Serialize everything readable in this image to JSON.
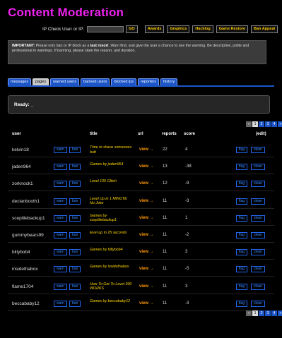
{
  "page": {
    "title": "Content Moderation"
  },
  "topbar": {
    "ip_label": "IP Check User or IP:",
    "ip_value": "",
    "go_label": "GO",
    "nav": [
      "Awards",
      "Graphics",
      "Hacklog",
      "Game Restore",
      "Ban Appeal"
    ]
  },
  "notice": {
    "bold_prefix": "IMPORTANT:",
    "part1": " Please only ban or IP block as a ",
    "last_resort": "last resort",
    "part2": ". Warn first, and give the user a chance to see the warning. Be descriptive, polite and professional in warnings. If banning, please state the reason, and duration."
  },
  "tabs": [
    {
      "label": "messages",
      "active": false
    },
    {
      "label": "pages",
      "active": true
    },
    {
      "label": "warned users",
      "active": false
    },
    {
      "label": "banned users",
      "active": false
    },
    {
      "label": "blocked ips",
      "active": false
    },
    {
      "label": "reporters",
      "active": false
    },
    {
      "label": "history",
      "active": false
    }
  ],
  "status": {
    "text": "Ready: _"
  },
  "pager": {
    "prev": "«",
    "pages": [
      "1",
      "2",
      "3",
      "4"
    ],
    "next": "»",
    "current": "1"
  },
  "table": {
    "headers": {
      "user": "user",
      "title": "title",
      "url": "url",
      "reports": "reports",
      "score": "score",
      "edit": "(edit)"
    },
    "warn_label": "warn",
    "ban_label": "ban",
    "flag_label": "flag",
    "clean_label": "clean",
    "view_label": "view →",
    "rows": [
      {
        "user": "kelvin18",
        "title": "Time to shave someones butt",
        "reports": "22",
        "score": "4"
      },
      {
        "user": "jaden964",
        "title": "Games by jaden964",
        "reports": "13",
        "score": "-38"
      },
      {
        "user": "zorknock1",
        "title": "Level 100 Glitch",
        "reports": "12",
        "score": "-9"
      },
      {
        "user": "declanbooth1",
        "title": "Level Up in 1 MINUTE No Joke",
        "reports": "11",
        "score": "-3"
      },
      {
        "user": "sceptilebackup1",
        "title": "Games by sceptilebackup1",
        "reports": "11",
        "score": "1"
      },
      {
        "user": "gummybears99",
        "title": "level up in 25 seconds",
        "reports": "11",
        "score": "-2"
      },
      {
        "user": "billybob4",
        "title": "Games by billybob4",
        "reports": "11",
        "score": "3"
      },
      {
        "user": "insidethabox",
        "title": "Games by insidethabox",
        "reports": "11",
        "score": "-5"
      },
      {
        "user": "flame1704",
        "title": "How To Get To Level 300 WORKS",
        "reports": "11",
        "score": "3"
      },
      {
        "user": "beccababy12",
        "title": "Games by beccababy12",
        "reports": "11",
        "score": "-3"
      }
    ]
  }
}
